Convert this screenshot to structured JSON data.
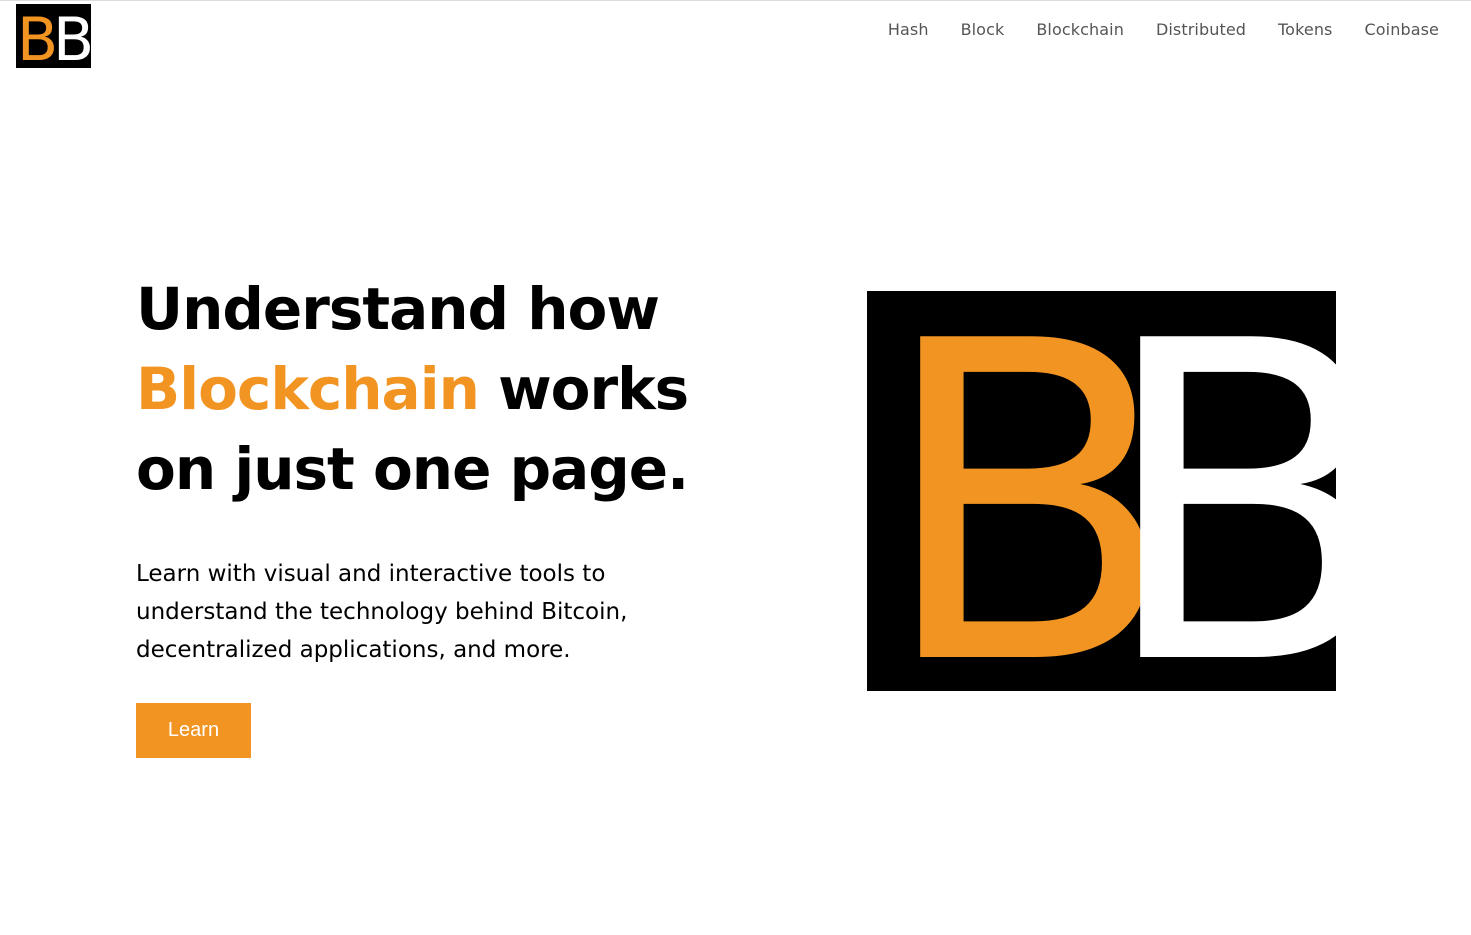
{
  "logo": {
    "letters": [
      "B",
      "B"
    ],
    "alt": "BB"
  },
  "nav": {
    "items": [
      {
        "label": "Hash"
      },
      {
        "label": "Block"
      },
      {
        "label": "Blockchain"
      },
      {
        "label": "Distributed"
      },
      {
        "label": "Tokens"
      },
      {
        "label": "Coinbase"
      }
    ]
  },
  "hero": {
    "headline_part1": "Understand how",
    "headline_accent": "Blockchain",
    "headline_part2": " works",
    "headline_part3": "on just one page.",
    "lead": "Learn with visual and interactive tools to understand the technology behind Bitcoin, decentralized applications, and more.",
    "button_label": "Learn"
  },
  "colors": {
    "accent": "#F29421",
    "text": "#000000",
    "nav_text": "#555555",
    "background": "#ffffff",
    "logo_background": "#000000",
    "logo_second_letter": "#ffffff"
  }
}
